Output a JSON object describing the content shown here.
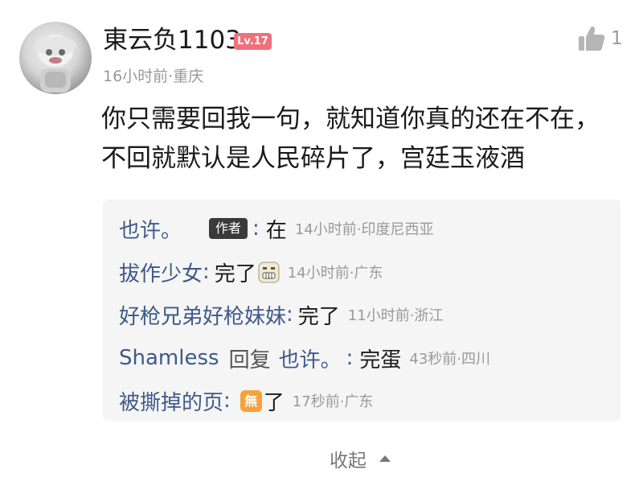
{
  "comment": {
    "username": "東云负1103",
    "level": "Lv.17",
    "meta": "16小时前·重庆",
    "likes": "1",
    "like_icon": "thumbs-up-icon",
    "body_lines": [
      "你只需要回我一句，就知道你真的还在不在，",
      "不回就默认是人民碎片了，宫廷玉液酒"
    ]
  },
  "replies": [
    {
      "author": "也许。",
      "tag": "作者",
      "separator": ":",
      "text": "在",
      "time": "14小时前·印度尼西亚"
    },
    {
      "author": "拔作少女",
      "separator": ":",
      "text": "完了",
      "emoji": "grimace-face-emoji",
      "time": "14小时前·广东"
    },
    {
      "author": "好枪兄弟好枪妹妹",
      "separator": ":",
      "text": "完了",
      "time": "11小时前·浙江"
    },
    {
      "author": "Shamless",
      "reply_word": "回复",
      "reply_to": "也许。",
      "separator": ":",
      "text": "完蛋",
      "time": "43秒前·四川"
    },
    {
      "author": "被撕掉的页",
      "separator": ":",
      "emoji_label": "無",
      "text": "了",
      "time": "17秒前·广东"
    }
  ],
  "collapse": {
    "label": "收起",
    "icon": "caret-up-icon"
  },
  "colors": {
    "username_link": "#3d5a8a",
    "level_badge": "#f0707a",
    "author_tag_bg": "#3a3a3a",
    "emoji_wu_bg": "#f6a23a",
    "muted_text": "#999999",
    "reply_box_bg": "#f5f5f5"
  }
}
